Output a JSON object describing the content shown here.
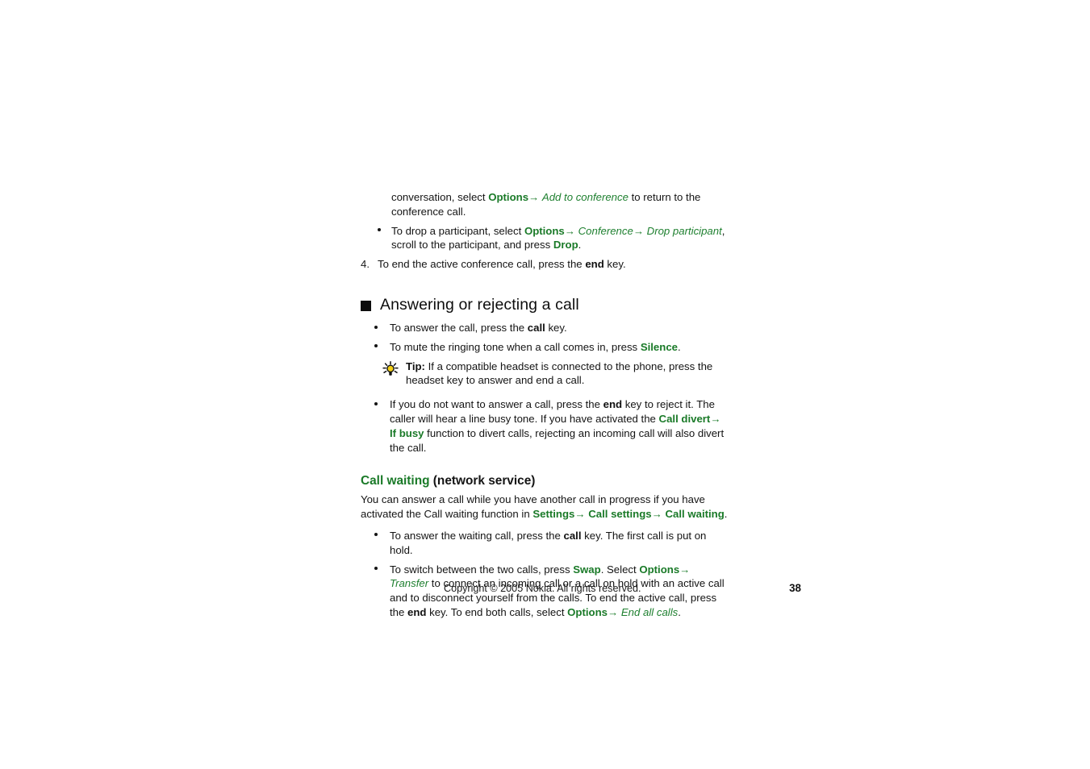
{
  "document": {
    "page_number": "38",
    "copyright": "Copyright © 2005 Nokia. All rights reserved."
  },
  "colors": {
    "accent_green": "#1a7a28",
    "italic_green": "#1f8030",
    "text_black": "#141414"
  },
  "content": {
    "conference_continuation": {
      "t1": "conversation, select ",
      "opt1": "Options",
      "arrow1": "→",
      "it1": "Add to conference",
      "t2": " to return to the conference call."
    },
    "drop_participant_bullet": {
      "t1": "To drop a participant, select ",
      "opt1": "Options",
      "arrow1": "→",
      "it1": "Conference",
      "arrow2": "→",
      "it2": "Drop participant",
      "t2": ", scroll to the participant, and press ",
      "opt2": "Drop",
      "t3": "."
    },
    "step_four": {
      "number": "4.",
      "t1": "To end the active conference call, press the ",
      "b1": "end",
      "t2": " key."
    },
    "heading_main": "Answering or rejecting a call",
    "answer_call_bullet": {
      "t1": "To answer the call, press the ",
      "b1": "call",
      "t2": " key."
    },
    "mute_ringing_bullet": {
      "t1": "To mute the ringing tone when a call comes in, press ",
      "opt1": "Silence",
      "t2": "."
    },
    "tip": {
      "label": "Tip:",
      "text": " If a compatible headset is connected to the phone, press the headset key to answer and end a call."
    },
    "reject_call_bullet": {
      "t1": "If you do not want to answer a call, press the ",
      "b1": "end",
      "t2": " key to reject it. The caller will hear a line busy tone. If you have activated the ",
      "opt1": "Call divert",
      "arrow1": "→",
      "opt2": "If busy",
      "t3": " function to divert calls, rejecting an incoming call will also divert the call."
    },
    "heading_call_waiting": {
      "green_part": "Call waiting",
      "black_part": " (network service)"
    },
    "call_waiting_intro": {
      "t1": "You can answer a call while you have another call in progress if you have activated the Call waiting function in ",
      "opt1": "Settings",
      "arrow1": "→",
      "opt2": "Call settings",
      "arrow2": "→",
      "opt3": "Call waiting",
      "t2": "."
    },
    "answer_waiting_bullet": {
      "t1": "To answer the waiting call, press the ",
      "b1": "call",
      "t2": " key. The first call is put on hold."
    },
    "switch_calls_bullet": {
      "t1": "To switch between the two calls, press ",
      "opt1": "Swap",
      "t2": ". Select ",
      "opt2": "Options",
      "arrow1": "→",
      "it1": "Transfer",
      "t3": " to connect an incoming call or a call on hold with an active call and to disconnect yourself from the calls. To end the active call, press the ",
      "b1": "end",
      "t4": " key. To end both calls, select ",
      "opt3": "Options",
      "arrow2": "→",
      "it2": "End all calls",
      "t5": "."
    }
  }
}
